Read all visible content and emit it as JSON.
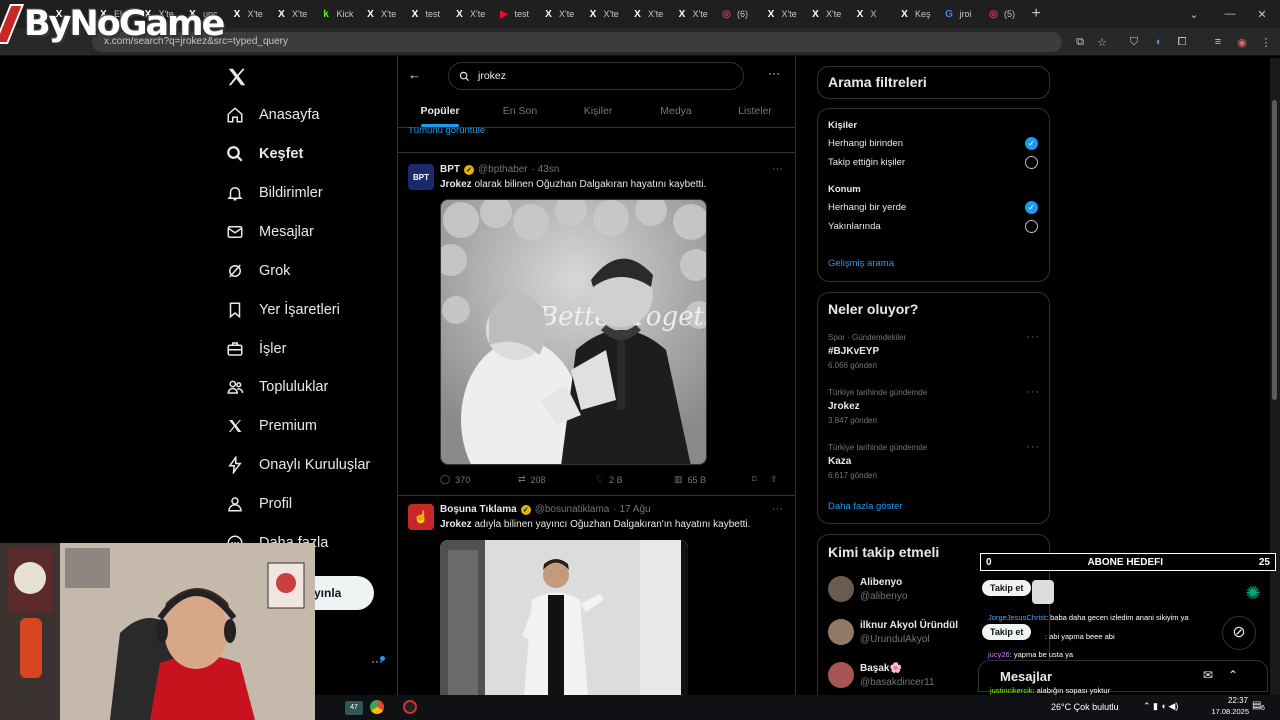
{
  "browser": {
    "tabs": [
      {
        "favicon": "k",
        "label": "",
        "color": "#53fc18"
      },
      {
        "favicon": "X",
        "label": "",
        "color": "#fff"
      },
      {
        "favicon": "X",
        "label": "Elo",
        "color": "#fff"
      },
      {
        "favicon": "X",
        "label": "X'te",
        "color": "#fff"
      },
      {
        "favicon": "X",
        "label": "unc",
        "color": "#fff"
      },
      {
        "favicon": "X",
        "label": "X'te",
        "color": "#fff"
      },
      {
        "favicon": "X",
        "label": "X'te",
        "color": "#fff"
      },
      {
        "favicon": "k",
        "label": "Kick",
        "color": "#53fc18"
      },
      {
        "favicon": "X",
        "label": "X'te",
        "color": "#fff"
      },
      {
        "favicon": "X",
        "label": "test",
        "color": "#fff"
      },
      {
        "favicon": "X",
        "label": "X'te",
        "color": "#fff"
      },
      {
        "favicon": "▶",
        "label": "test",
        "color": "#ff0033"
      },
      {
        "favicon": "X",
        "label": "X'te",
        "color": "#fff"
      },
      {
        "favicon": "X",
        "label": "X'te",
        "color": "#fff"
      },
      {
        "favicon": "X",
        "label": "X'te",
        "color": "#fff"
      },
      {
        "favicon": "X",
        "label": "X'te",
        "color": "#fff"
      },
      {
        "favicon": "◎",
        "label": "(6)",
        "color": "#e1306c"
      },
      {
        "favicon": "X",
        "label": "X'te",
        "color": "#fff"
      },
      {
        "favicon": "X",
        "label": "X'te",
        "color": "#fff"
      },
      {
        "favicon": "X",
        "label": "X",
        "color": "#fff"
      },
      {
        "favicon": "X",
        "label": "Keş",
        "color": "#fff"
      },
      {
        "favicon": "G",
        "label": "jroi",
        "color": "#4285f4"
      },
      {
        "favicon": "◎",
        "label": "(5)",
        "color": "#e1306c"
      }
    ],
    "new_tab": "+",
    "url": "x.com/search?q=jrokez&src=typed_query"
  },
  "overlay": {
    "logo_text": "ByNoGame",
    "sub_goal": {
      "current": "0",
      "label": "ABONE HEDEFI",
      "target": "25"
    },
    "chat": [
      {
        "badge": "Takip et",
        "user": "",
        "msg": ""
      },
      {
        "user": "JorgeJesusChrist",
        "msg": ": baba daha gecen izledim anani sikiyim ya"
      },
      {
        "badge": "Takip et",
        "user": "",
        "msg": ": abi yapma beee abi"
      },
      {
        "user": "jucy26",
        "msg": ": yapma be usta ya"
      },
      {
        "badge": "Mesajlar",
        "user": "",
        "msg": ""
      },
      {
        "user": "justincikercik",
        "msg": ": alabığın sopası yoktur"
      }
    ]
  },
  "taskbar": {
    "weather": "26°C  Çok bulutlu",
    "time": "22:37",
    "date": "17.08.2025",
    "badge": "47",
    "notif": "6"
  },
  "nav": {
    "items": [
      {
        "label": "Anasayfa",
        "icon": "home-icon"
      },
      {
        "label": "Keşfet",
        "icon": "search-icon"
      },
      {
        "label": "Bildirimler",
        "icon": "bell-icon"
      },
      {
        "label": "Mesajlar",
        "icon": "mail-icon"
      },
      {
        "label": "Grok",
        "icon": "grok-icon"
      },
      {
        "label": "Yer İşaretleri",
        "icon": "bookmark-icon"
      },
      {
        "label": "İşler",
        "icon": "briefcase-icon"
      },
      {
        "label": "Topluluklar",
        "icon": "people-icon"
      },
      {
        "label": "Premium",
        "icon": "x-icon"
      },
      {
        "label": "Onaylı Kuruluşlar",
        "icon": "lightning-icon"
      },
      {
        "label": "Profil",
        "icon": "person-icon"
      },
      {
        "label": "Daha fazla",
        "icon": "more-circle-icon"
      }
    ],
    "post_button": "yınla"
  },
  "search": {
    "query": "jrokez",
    "tabs": [
      "Popüler",
      "En Son",
      "Kişiler",
      "Medya",
      "Listeler"
    ],
    "see_all": "Tümünü görüntüle"
  },
  "tweets": [
    {
      "name": "BPT",
      "handle": "@bpthaber",
      "time": "· 43sn",
      "text_bold": "Jrokez",
      "text": " olarak bilinen Oğuzhan Dalgakıran hayatını kaybetti.",
      "image_text": "Better Together",
      "replies": "370",
      "retweets": "208",
      "likes": "2 B",
      "views": "65 B"
    },
    {
      "name": "Boşuna Tıklama",
      "handle": "@bosunatiklama",
      "time": "· 17 Ağu",
      "text_bold": "Jrokez",
      "text": " adıyla bilinen yayıncı Oğuzhan Dalgakıran'ın hayatını kaybetti."
    }
  ],
  "filters": {
    "title": "Arama filtreleri",
    "people_label": "Kişiler",
    "people_options": [
      "Herhangi birinden",
      "Takip ettiğin kişiler"
    ],
    "location_label": "Konum",
    "location_options": [
      "Herhangi bir yerde",
      "Yakınlarında"
    ],
    "advanced": "Gelişmiş arama"
  },
  "trends": {
    "title": "Neler oluyor?",
    "items": [
      {
        "context": "Spor · Gündemdekiler",
        "name": "#BJKvEYP",
        "count": "6.066 gönderi"
      },
      {
        "context": "Türkiye tarihinde gündemde",
        "name": "Jrokez",
        "count": "3.847 gönderi"
      },
      {
        "context": "Türkiye tarihinde gündemde",
        "name": "Kaza",
        "count": "6.617 gönderi"
      }
    ],
    "show_more": "Daha fazla göster"
  },
  "who_to_follow": {
    "title": "Kimi takip etmeli",
    "users": [
      {
        "name": "Alibenyo",
        "handle": "@alibenyo"
      },
      {
        "name": "ilknur Akyol Üründül",
        "handle": "@UrundulAkyol"
      },
      {
        "name": "Başak🌸",
        "handle": "@basakdincer11"
      }
    ]
  },
  "colors": {
    "accent": "#1d9bf0",
    "background": "#000000",
    "border": "#2f3336",
    "muted": "#71767b"
  }
}
